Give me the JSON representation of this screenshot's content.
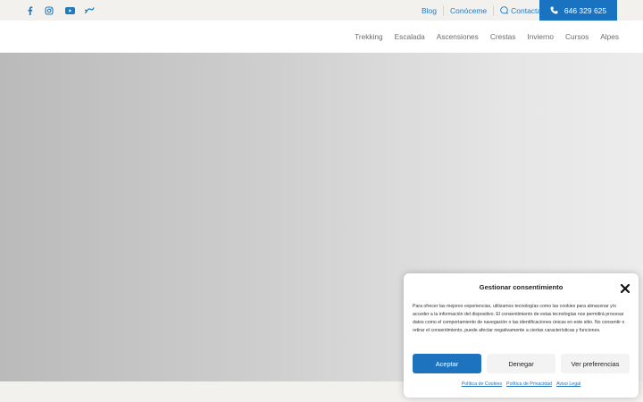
{
  "topbar": {
    "social_icons": [
      "facebook-icon",
      "instagram-icon",
      "youtube-icon",
      "wikiloc-icon"
    ],
    "links": {
      "blog": "Blog",
      "about": "Conóceme",
      "contact": "Contacta"
    },
    "phone": "646 329 625"
  },
  "nav": {
    "items": [
      "Trekking",
      "Escalada",
      "Ascensiones",
      "Crestas",
      "Invierno",
      "Cursos",
      "Alpes"
    ]
  },
  "consent": {
    "title": "Gestionar consentimiento",
    "body": "Para ofrecer las mejores experiencias, utilizamos tecnologías como las cookies para almacenar y/o acceder a la información del dispositivo. El consentimiento de estas tecnologías nos permitirá procesar datos como el comportamiento de navegación o las identificaciones únicas en este sitio. No consentir o retirar el consentimiento, puede afectar negativamente a ciertas características y funciones.",
    "accept": "Aceptar",
    "deny": "Denegar",
    "preferences": "Ver preferencias",
    "links": {
      "cookies": "Política de Cookies",
      "privacy": "Política de Privacidad",
      "legal": "Aviso Legal"
    }
  },
  "colors": {
    "accent": "#1e73be",
    "topbar_bg": "#f3f1ee"
  }
}
